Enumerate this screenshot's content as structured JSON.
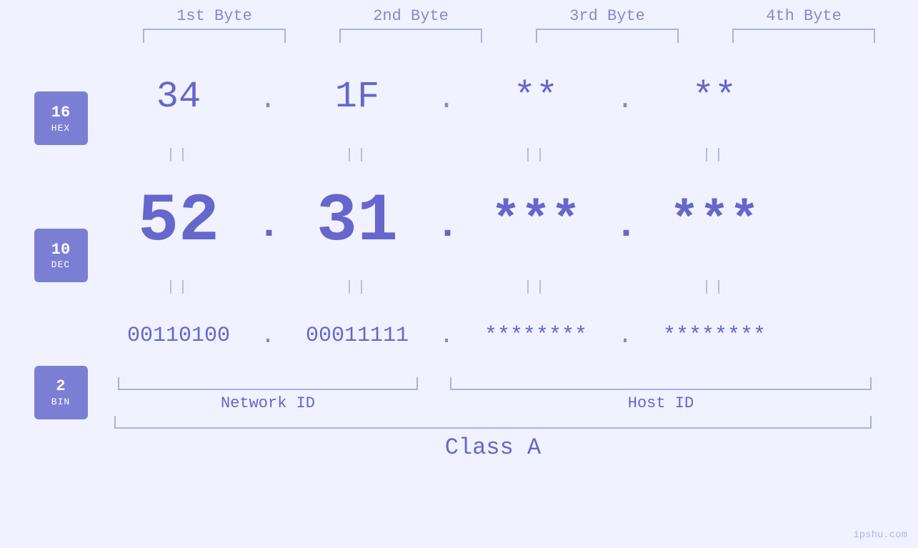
{
  "header": {
    "byte1_label": "1st Byte",
    "byte2_label": "2nd Byte",
    "byte3_label": "3rd Byte",
    "byte4_label": "4th Byte"
  },
  "badges": {
    "hex": {
      "num": "16",
      "label": "HEX"
    },
    "dec": {
      "num": "10",
      "label": "DEC"
    },
    "bin": {
      "num": "2",
      "label": "BIN"
    }
  },
  "hex_row": {
    "b1": "34",
    "b2": "1F",
    "b3": "**",
    "b4": "**",
    "dots": [
      ".",
      ".",
      "."
    ]
  },
  "dec_row": {
    "b1": "52",
    "b2": "31",
    "b3": "***",
    "b4": "***",
    "dots": [
      ".",
      ".",
      "."
    ]
  },
  "bin_row": {
    "b1": "00110100",
    "b2": "00011111",
    "b3": "********",
    "b4": "********",
    "dots": [
      ".",
      ".",
      "."
    ]
  },
  "labels": {
    "network_id": "Network ID",
    "host_id": "Host ID",
    "class": "Class A"
  },
  "watermark": "ipshu.com",
  "separator": "||"
}
